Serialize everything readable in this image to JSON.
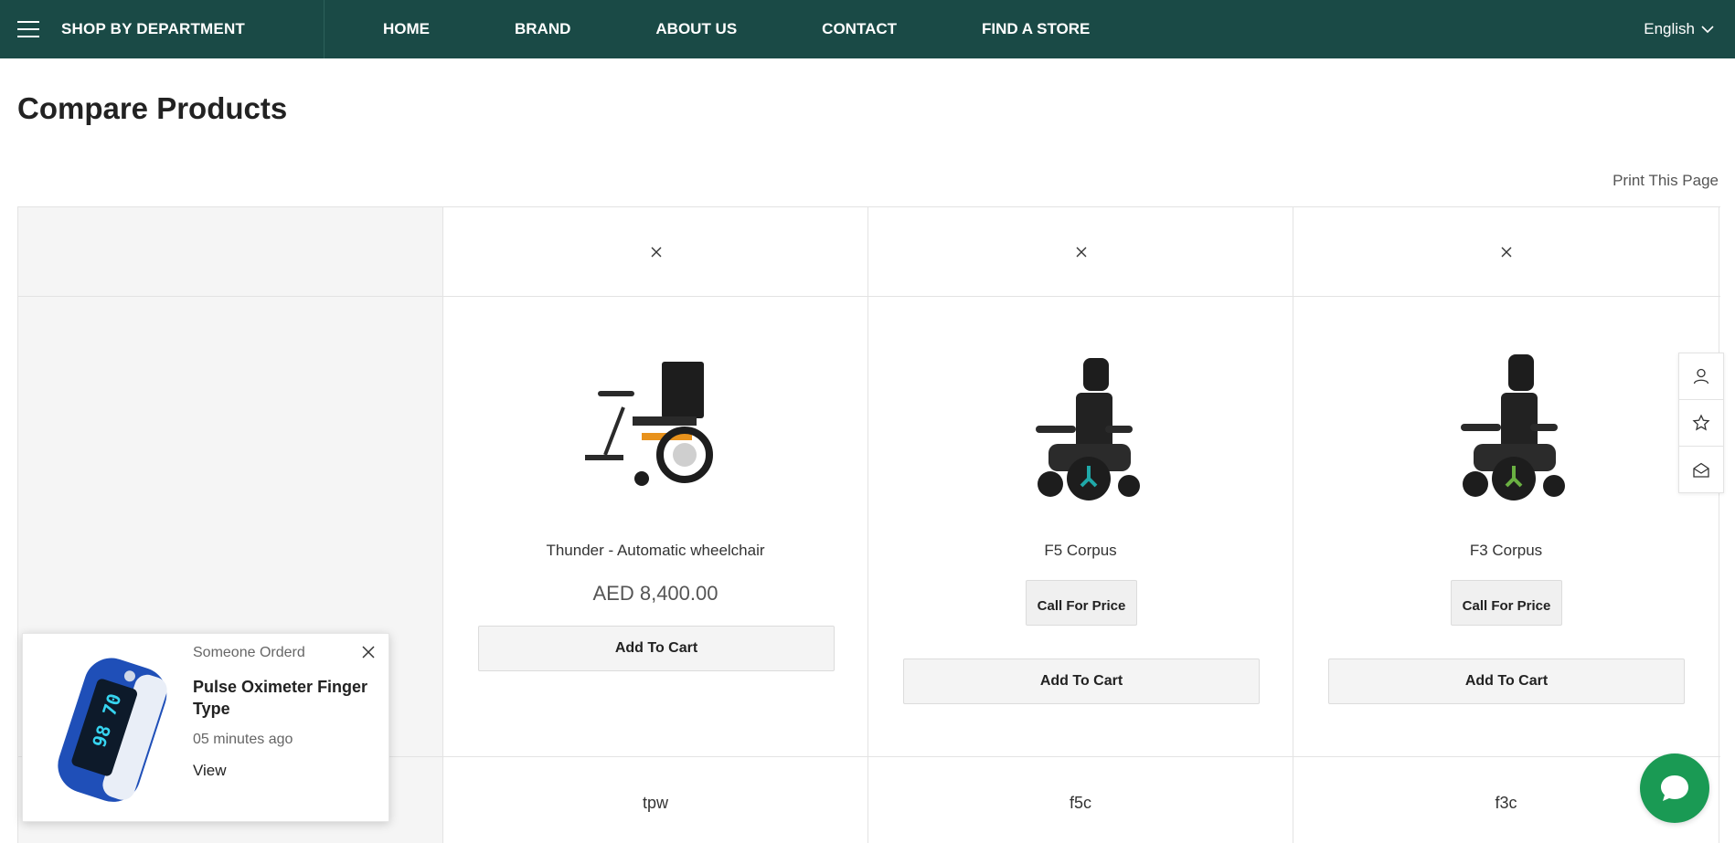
{
  "nav": {
    "department": "SHOP BY DEPARTMENT",
    "menu": [
      "HOME",
      "BRAND",
      "ABOUT US",
      "CONTACT",
      "FIND A STORE"
    ],
    "language": "English"
  },
  "page": {
    "title": "Compare Products",
    "print": "Print This Page"
  },
  "products": [
    {
      "name": "Thunder - Automatic wheelchair",
      "price": "AED 8,400.00",
      "cart": "Add To Cart",
      "sku": "tpw",
      "accent": "#e8921c"
    },
    {
      "name": "F5 Corpus",
      "call": "Call For Price",
      "cart": "Add To Cart",
      "sku": "f5c",
      "accent": "#1fa8a8"
    },
    {
      "name": "F3 Corpus",
      "call": "Call For Price",
      "cart": "Add To Cart",
      "sku": "f3c",
      "accent": "#6ab042"
    }
  ],
  "popup": {
    "heading": "Someone Orderd",
    "product": "Pulse Oximeter Finger Type",
    "time": "05 minutes ago",
    "view": "View",
    "screen_text": "98 70"
  },
  "icons": {
    "menu": "hamburger-icon",
    "language": "chevron-down-icon",
    "remove": "close-icon",
    "tools": [
      "user-icon",
      "star-icon",
      "mail-icon"
    ],
    "chat": "chat-icon"
  },
  "colors": {
    "nav_bg": "#1a4a46",
    "chat_bg": "#1a9a54"
  }
}
